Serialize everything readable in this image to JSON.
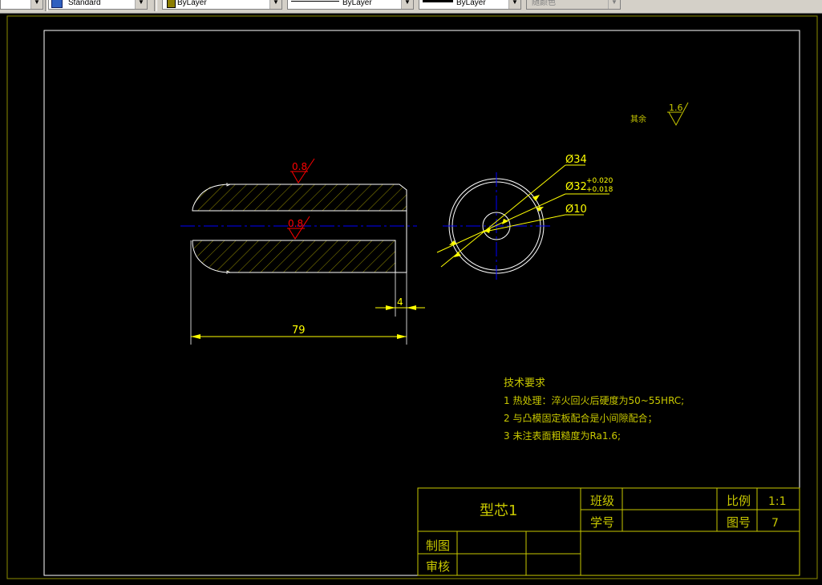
{
  "toolbar": {
    "text_style": "Standard",
    "layer_color": "ByLayer",
    "linetype": "ByLayer",
    "lineweight": "ByLayer",
    "plot_style": "随颜色",
    "layer_swatch_color": "#8b7d00"
  },
  "drawing": {
    "surface_finish_top": "0.8",
    "surface_finish_bore": "0.8",
    "dim_length": "79",
    "dim_shoulder": "4",
    "dim_outer_dia": "Ø34",
    "dim_mid_dia": "Ø32",
    "dim_mid_tol_upper": "+0.020",
    "dim_mid_tol_lower": "+0.018",
    "dim_bore_dia": "Ø10",
    "rest_label": "其余",
    "rest_roughness": "1.6",
    "colors": {
      "outline": "#ffffff",
      "dimension": "#ffff00",
      "centerline": "#0000ff",
      "finish": "#ff0000",
      "hatch": "#b8b000",
      "frame_text": "#c8c800"
    }
  },
  "notes": {
    "title": "技术要求",
    "items": [
      "1 热处理：淬火回火后硬度为50~55HRC;",
      "2 与凸模固定板配合是小间隙配合；",
      "3 未注表面粗糙度为Ra1.6;"
    ]
  },
  "title_block": {
    "part_name": "型芯1",
    "class_label": "班级",
    "scale_label": "比例",
    "scale_value": "1:1",
    "student_id_label": "学号",
    "drawing_no_label": "图号",
    "drawing_no_value": "7",
    "drawn_by_label": "制图",
    "checked_by_label": "审核"
  }
}
